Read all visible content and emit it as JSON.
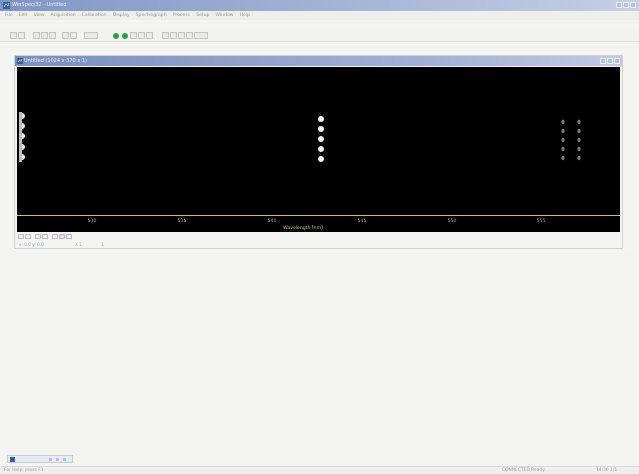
{
  "app": {
    "title": "WinSpec/32 - Untitled",
    "icon": "app-icon"
  },
  "menu": [
    "File",
    "Edit",
    "View",
    "Acquisition",
    "Calibration",
    "Display",
    "Spectrograph",
    "Process",
    "Setup",
    "Window",
    "Help"
  ],
  "document": {
    "title": "Untitled (1024 x 370 x 1)"
  },
  "axis": {
    "ticks": [
      "530",
      "535",
      "540",
      "545",
      "550",
      "555"
    ],
    "title": "Wavelength [nm]"
  },
  "doc_status": {
    "coords": "x: 0.0  y: 0.0",
    "field2": "X  1",
    "field3": "1"
  },
  "statusbar": {
    "left": "For Help, press F1",
    "middle": "CONNECTED  Ready",
    "right": "14:36  1/1"
  },
  "colors": {
    "title_gradient_start": "#7f95c4",
    "spectrum_bg": "#000000",
    "axis_accent": "#d9c74e",
    "toolbar_green": "#27a04a"
  }
}
